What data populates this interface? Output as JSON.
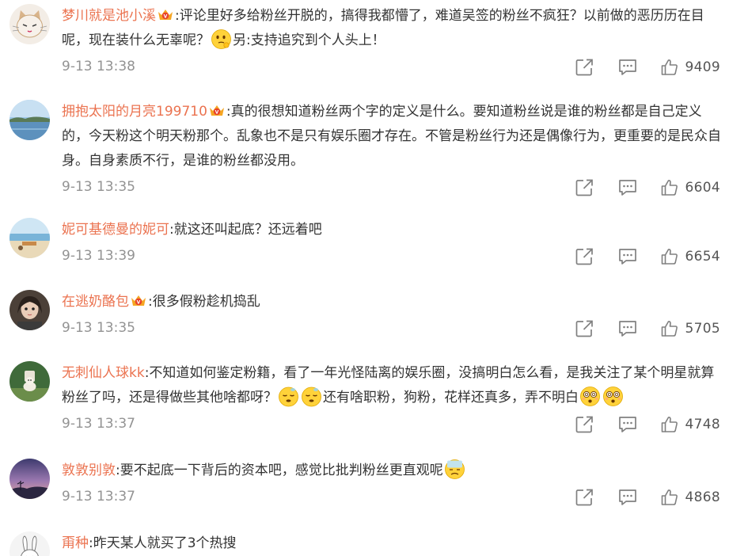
{
  "comments": [
    {
      "username": "梦川就是池小溪",
      "has_vip": true,
      "segments": [
        {
          "t": "text",
          "v": ":评论里好多给粉丝开脱的，搞得我都懵了，难道吴签的粉丝不疯狂？以前做的恶历历在目呢，现在装什么无辜呢？"
        },
        {
          "t": "emoji",
          "v": "think"
        },
        {
          "t": "text",
          "v": "另:支持追究到个人头上！"
        }
      ],
      "time": "9-13 13:38",
      "likes": "9409",
      "avatar": "cat"
    },
    {
      "username": "拥抱太阳的月亮199710",
      "has_vip": true,
      "segments": [
        {
          "t": "text",
          "v": ":真的很想知道粉丝两个字的定义是什么。要知道粉丝说是谁的粉丝都是自己定义的，今天粉这个明天粉那个。乱象也不是只有娱乐圈才存在。不管是粉丝行为还是偶像行为，更重要的是民众自身。自身素质不行，是谁的粉丝都没用。"
        }
      ],
      "time": "9-13 13:35",
      "likes": "6604",
      "avatar": "lake"
    },
    {
      "username": "妮可基德曼的妮可",
      "has_vip": false,
      "segments": [
        {
          "t": "text",
          "v": ":就这还叫起底？还远着吧"
        }
      ],
      "time": "9-13 13:39",
      "likes": "6654",
      "avatar": "beach"
    },
    {
      "username": "在逃奶酪包",
      "has_vip": true,
      "segments": [
        {
          "t": "text",
          "v": ":很多假粉趁机捣乱"
        }
      ],
      "time": "9-13 13:35",
      "likes": "5705",
      "avatar": "girl"
    },
    {
      "username": "无刺仙人球kk",
      "has_vip": false,
      "segments": [
        {
          "t": "text",
          "v": ":不知道如何鉴定粉籍，看了一年光怪陆离的娱乐圈，没搞明白怎么看，是我关注了某个明星就算粉丝了吗，还是得做些其他啥都呀？"
        },
        {
          "t": "emoji",
          "v": "sleepy"
        },
        {
          "t": "emoji",
          "v": "sleepy"
        },
        {
          "t": "text",
          "v": "还有啥职粉，狗粉，花样还真多，弄不明白"
        },
        {
          "t": "emoji",
          "v": "dizzy"
        },
        {
          "t": "emoji",
          "v": "dizzy"
        }
      ],
      "time": "9-13 13:37",
      "likes": "4748",
      "avatar": "dog"
    },
    {
      "username": "敦敦别敦",
      "has_vip": false,
      "segments": [
        {
          "t": "text",
          "v": ":要不起底一下背后的资本吧，感觉比批判粉丝更直观呢"
        },
        {
          "t": "emoji",
          "v": "sick"
        }
      ],
      "time": "9-13 13:37",
      "likes": "4868",
      "avatar": "sunset"
    },
    {
      "username": "甭种",
      "has_vip": false,
      "segments": [
        {
          "t": "text",
          "v": ":昨天某人就买了3个热搜"
        }
      ],
      "time": "",
      "likes": "",
      "avatar": "bunny"
    }
  ],
  "icons": {
    "vip": "crown-vip-icon",
    "share": "share-icon",
    "comment": "comment-icon",
    "like": "like-icon"
  },
  "colors": {
    "username": "#eb7350",
    "text": "#333333",
    "time": "#939393",
    "icon": "#808080",
    "crown": "#f5a623"
  }
}
